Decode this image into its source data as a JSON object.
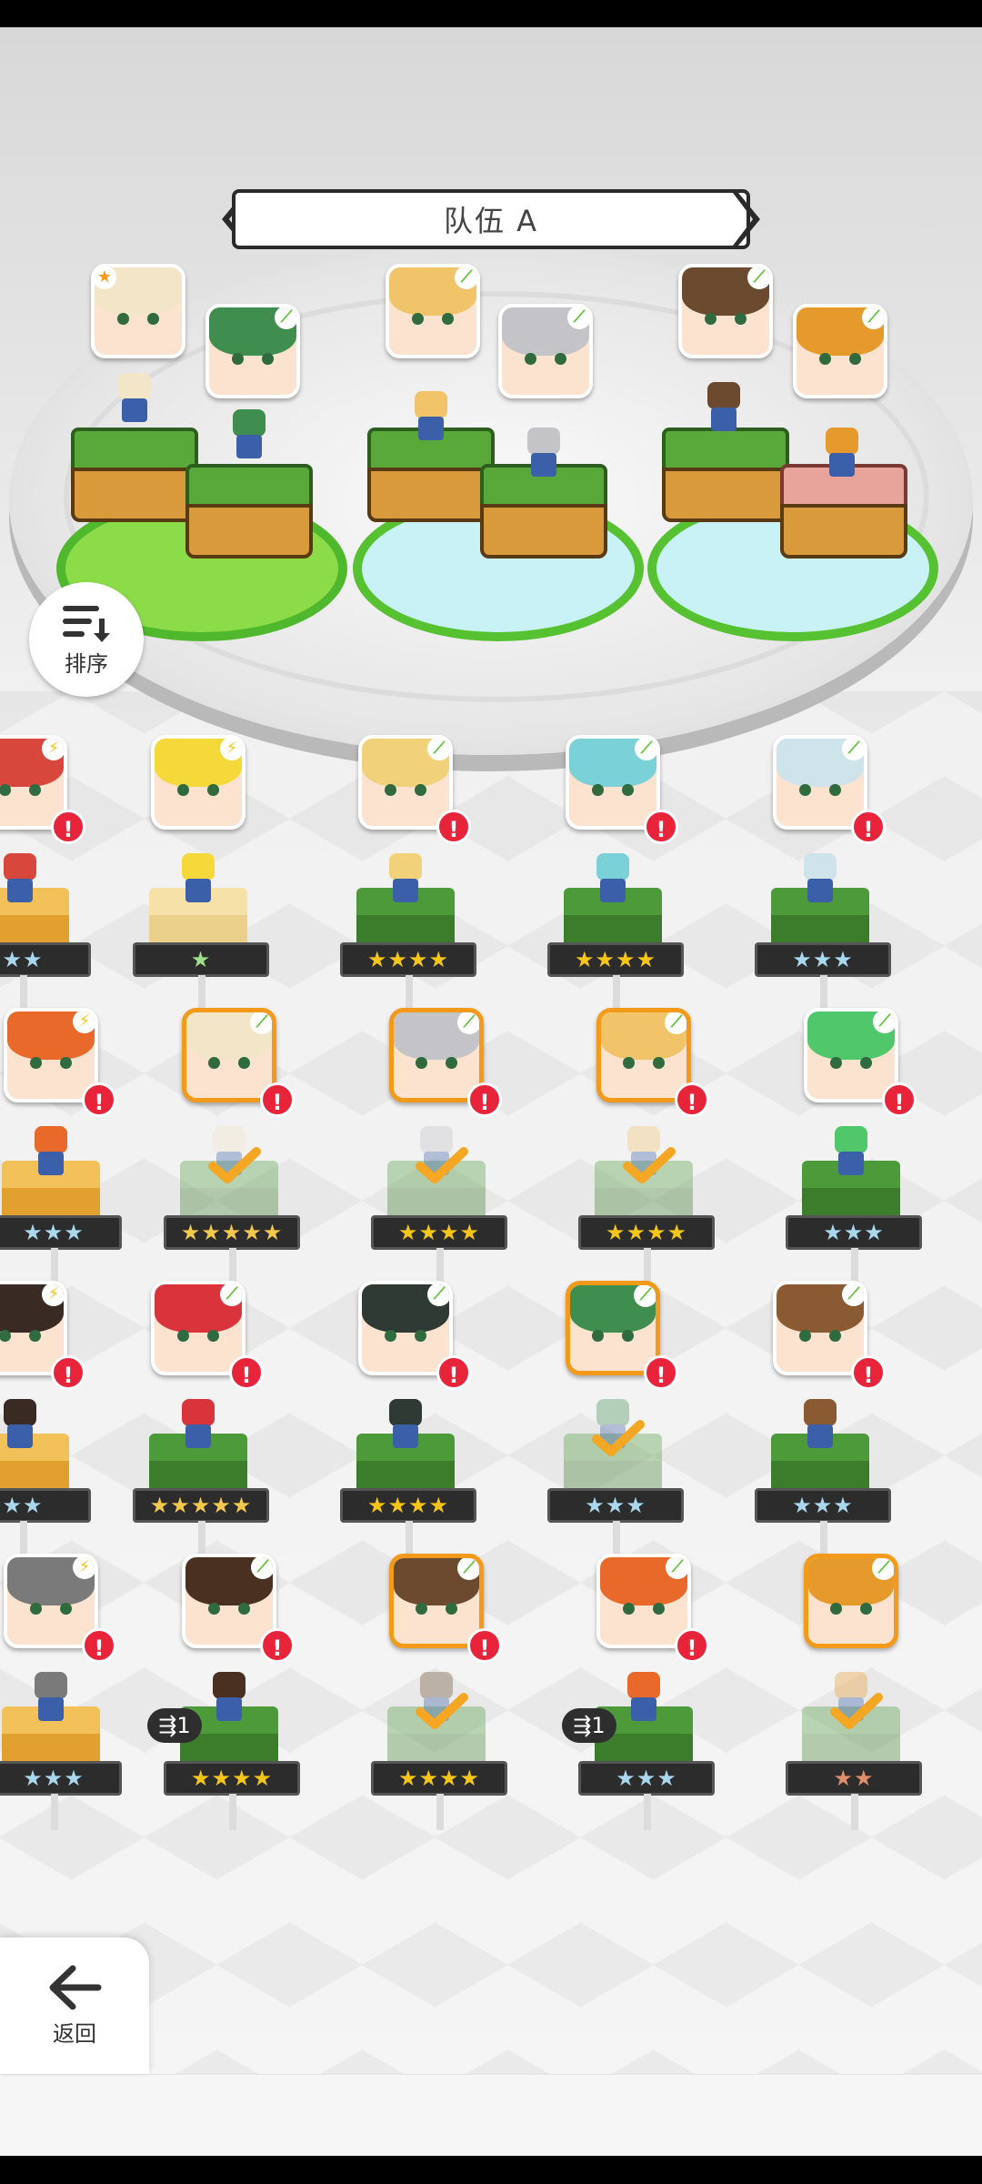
{
  "team": {
    "title": "队伍 A"
  },
  "buttons": {
    "sort_label": "排序",
    "back_label": "返回"
  },
  "icons": {
    "sort": "sort-descending-icon",
    "back": "arrow-left-icon",
    "prev": "chevron-left-icon",
    "next": "chevron-right-icon"
  },
  "colors": {
    "alert": "#e8243a",
    "selected_border": "#f39a1a",
    "grass_element": "#5cc234",
    "thunder_element": "#f4c51d"
  },
  "team_members": [
    {
      "element": "star",
      "hair": "#f3e6c8"
    },
    {
      "element": "grass",
      "hair": "#3f8d4f"
    },
    {
      "element": "grass",
      "hair": "#f2c46a"
    },
    {
      "element": "grass",
      "hair": "#c4c4c8"
    },
    {
      "element": "grass",
      "hair": "#6b4a30"
    },
    {
      "element": "grass",
      "hair": "#e79a2c"
    }
  ],
  "roster": [
    {
      "element": "bolt",
      "hair": "#d8473b",
      "stars": "★★",
      "star_tier": "silver",
      "alert": "!",
      "selected": false,
      "checked": false,
      "badge": "",
      "block": "gold"
    },
    {
      "element": "bolt",
      "hair": "#f5d93a",
      "stars": "★",
      "star_tier": "green",
      "alert": "",
      "selected": false,
      "checked": false,
      "badge": "",
      "block": "cream"
    },
    {
      "element": "grass",
      "hair": "#f1d27a",
      "stars": "★★★★",
      "star_tier": "gold",
      "alert": "!",
      "selected": false,
      "checked": false,
      "badge": "",
      "block": "grass"
    },
    {
      "element": "grass",
      "hair": "#7ad1d8",
      "stars": "★★★★",
      "star_tier": "gold",
      "alert": "!",
      "selected": false,
      "checked": false,
      "badge": "",
      "block": "grass"
    },
    {
      "element": "grass",
      "hair": "#cfe3ea",
      "stars": "★★★",
      "star_tier": "silver",
      "alert": "!",
      "selected": false,
      "checked": false,
      "badge": "",
      "block": "grass"
    },
    {
      "element": "bolt",
      "hair": "#e8692a",
      "stars": "★★★",
      "star_tier": "silver",
      "alert": "!",
      "selected": false,
      "checked": false,
      "badge": "",
      "block": "gold"
    },
    {
      "element": "grass",
      "hair": "#f3e6c8",
      "stars": "★★★★★",
      "star_tier": "rainbow",
      "alert": "!",
      "selected": true,
      "checked": true,
      "badge": "",
      "block": "grass"
    },
    {
      "element": "grass",
      "hair": "#c4c4c8",
      "stars": "★★★★",
      "star_tier": "gold",
      "alert": "!",
      "selected": true,
      "checked": true,
      "badge": "",
      "block": "grass"
    },
    {
      "element": "grass",
      "hair": "#f2c46a",
      "stars": "★★★★",
      "star_tier": "gold",
      "alert": "!",
      "selected": true,
      "checked": true,
      "badge": "",
      "block": "grass"
    },
    {
      "element": "grass",
      "hair": "#4fc76a",
      "stars": "★★★",
      "star_tier": "silver",
      "alert": "!",
      "selected": false,
      "checked": false,
      "badge": "",
      "block": "grass"
    },
    {
      "element": "bolt",
      "hair": "#3a2a24",
      "stars": "★★",
      "star_tier": "silver",
      "alert": "!",
      "selected": false,
      "checked": false,
      "badge": "",
      "block": "gold"
    },
    {
      "element": "grass",
      "hair": "#d9333c",
      "stars": "★★★★★",
      "star_tier": "rainbow",
      "alert": "!",
      "selected": false,
      "checked": false,
      "badge": "",
      "block": "grass"
    },
    {
      "element": "grass",
      "hair": "#2f3a34",
      "stars": "★★★★",
      "star_tier": "gold",
      "alert": "!",
      "selected": false,
      "checked": false,
      "badge": "",
      "block": "grass"
    },
    {
      "element": "grass",
      "hair": "#3f8d4f",
      "stars": "★★★",
      "star_tier": "silver",
      "alert": "!",
      "selected": true,
      "checked": true,
      "badge": "",
      "block": "grass"
    },
    {
      "element": "grass",
      "hair": "#8a5a32",
      "stars": "★★★",
      "star_tier": "silver",
      "alert": "!",
      "selected": false,
      "checked": false,
      "badge": "",
      "block": "grass"
    },
    {
      "element": "bolt",
      "hair": "#7a7a7a",
      "stars": "★★★",
      "star_tier": "silver",
      "alert": "!",
      "selected": false,
      "checked": false,
      "badge": "",
      "block": "gold"
    },
    {
      "element": "grass",
      "hair": "#4a3020",
      "stars": "★★★★",
      "star_tier": "gold",
      "alert": "!",
      "selected": false,
      "checked": false,
      "badge": "1",
      "block": "grass"
    },
    {
      "element": "grass",
      "hair": "#6b4a30",
      "stars": "★★★★",
      "star_tier": "gold",
      "alert": "!",
      "selected": true,
      "checked": true,
      "badge": "",
      "block": "grass"
    },
    {
      "element": "grass",
      "hair": "#e8692a",
      "stars": "★★★",
      "star_tier": "silver",
      "alert": "!",
      "selected": false,
      "checked": false,
      "badge": "1",
      "block": "grass"
    },
    {
      "element": "grass",
      "hair": "#e79a2c",
      "stars": "★★",
      "star_tier": "bronze",
      "alert": "",
      "selected": true,
      "checked": true,
      "badge": "",
      "block": "grass"
    }
  ]
}
